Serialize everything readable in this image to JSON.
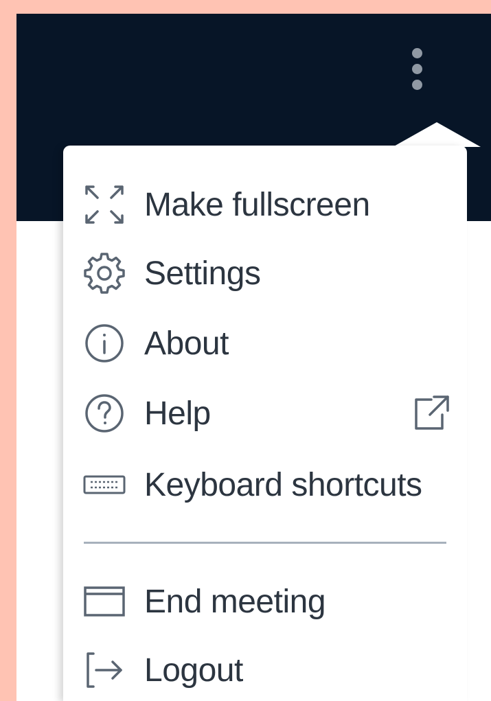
{
  "colors": {
    "background": "#FFC3B3",
    "header": "#071527",
    "menu_bg": "#FFFFFF",
    "text": "#2C3540",
    "icon": "#5A6572",
    "divider": "#A7B1BC",
    "kebab_dots": "#9099A4"
  },
  "header": {
    "more_options_icon": "kebab-vertical-icon"
  },
  "menu": {
    "items": [
      {
        "label": "Make fullscreen",
        "icon": "fullscreen-icon"
      },
      {
        "label": "Settings",
        "icon": "gear-icon"
      },
      {
        "label": "About",
        "icon": "info-icon"
      },
      {
        "label": "Help",
        "icon": "help-icon",
        "external_icon": "external-link-icon"
      },
      {
        "label": "Keyboard shortcuts",
        "icon": "keyboard-icon"
      },
      {
        "label": "End meeting",
        "icon": "window-icon"
      },
      {
        "label": "Logout",
        "icon": "logout-icon"
      }
    ]
  }
}
